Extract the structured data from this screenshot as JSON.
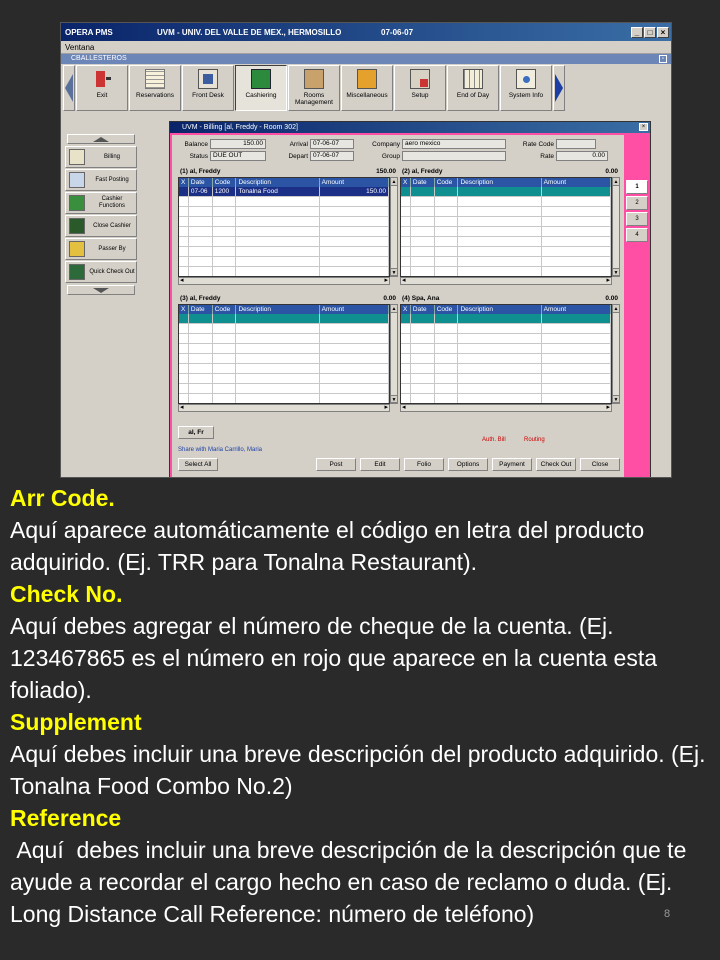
{
  "app": {
    "title_left": "OPERA PMS",
    "title_center": "UVM - UNIV. DEL VALLE DE MEX., HERMOSILLO",
    "title_date": "07-06-07",
    "menu": "Ventana",
    "user": "CBALLESTEROS"
  },
  "toolbar": [
    {
      "label": "Exit",
      "icon": "exit-icon"
    },
    {
      "label": "Reservations",
      "icon": "calendar-icon"
    },
    {
      "label": "Front Desk",
      "icon": "front-desk-icon"
    },
    {
      "label": "Cashiering",
      "icon": "cash-register-icon"
    },
    {
      "label": "Rooms Management",
      "icon": "rooms-icon"
    },
    {
      "label": "Miscellaneous",
      "icon": "misc-icon"
    },
    {
      "label": "Setup",
      "icon": "setup-icon"
    },
    {
      "label": "End of Day",
      "icon": "end-of-day-icon"
    },
    {
      "label": "System Info",
      "icon": "system-info-icon"
    }
  ],
  "leftpanel": [
    {
      "label": "Billing"
    },
    {
      "label": "Fast Posting"
    },
    {
      "label": "Cashier Functions"
    },
    {
      "label": "Close Cashier"
    },
    {
      "label": "Passer By"
    },
    {
      "label": "Quick Check Out"
    }
  ],
  "billing": {
    "title": "UVM - Billing  [al, Freddy - Room 302]",
    "balance_label": "Balance",
    "balance": "150.00",
    "status_label": "Status",
    "status": "DUE OUT",
    "arrival_label": "Arrival",
    "arrival": "07-06-07",
    "depart_label": "Depart",
    "depart": "07-06-07",
    "company_label": "Company",
    "company": "aero mexico",
    "group_label": "Group",
    "group": "",
    "ratecode_label": "Rate Code",
    "ratecode": "",
    "rate_label": "Rate",
    "rate": "0.00",
    "columns": {
      "x": "X",
      "date": "Date",
      "code": "Code",
      "desc": "Description",
      "amount": "Amount"
    },
    "windows": [
      {
        "title": "(1) al, Freddy",
        "total": "150.00",
        "rows": [
          {
            "date": "07-06",
            "code": "1200",
            "desc": "Tonalna Food",
            "amount": "150.00"
          }
        ]
      },
      {
        "title": "(2) al, Freddy",
        "total": "0.00",
        "rows": []
      },
      {
        "title": "(3) al, Freddy",
        "total": "0.00",
        "rows": []
      },
      {
        "title": "(4) Spa, Ana",
        "total": "0.00",
        "rows": []
      }
    ],
    "window_tabs": [
      "1",
      "2",
      "3",
      "4"
    ],
    "guest_button": "al, Fr",
    "auth_bill": "Auth. Bill",
    "routing": "Routing",
    "share": "Share with Maria Carrillo, Maria",
    "buttons": {
      "select_all": "Select All",
      "post": "Post",
      "edit": "Edit",
      "folio": "Folio",
      "options": "Options",
      "payment": "Payment",
      "check_out": "Check Out",
      "close": "Close"
    }
  },
  "slide": {
    "items": [
      {
        "heading": "Arr Code.",
        "body": "Aquí aparece automáticamente el código en letra del producto adquirido. (Ej. TRR para Tonalna Restaurant)."
      },
      {
        "heading": "Check No.",
        "body": "Aquí debes agregar el número de cheque de la cuenta. (Ej. 123467865 es el número en rojo que aparece en la cuenta esta foliado)."
      },
      {
        "heading": "Supplement",
        "body": "Aquí debes incluir una breve descripción del producto adquirido. (Ej. Tonalna Food  Combo No.2)"
      },
      {
        "heading": "Reference",
        "body": " Aquí  debes incluir una breve descripción de la descripción que te ayude a recordar el cargo hecho en caso de reclamo o duda. (Ej. Long Distance Call Reference: número de teléfono)"
      }
    ],
    "page_number": "8"
  }
}
